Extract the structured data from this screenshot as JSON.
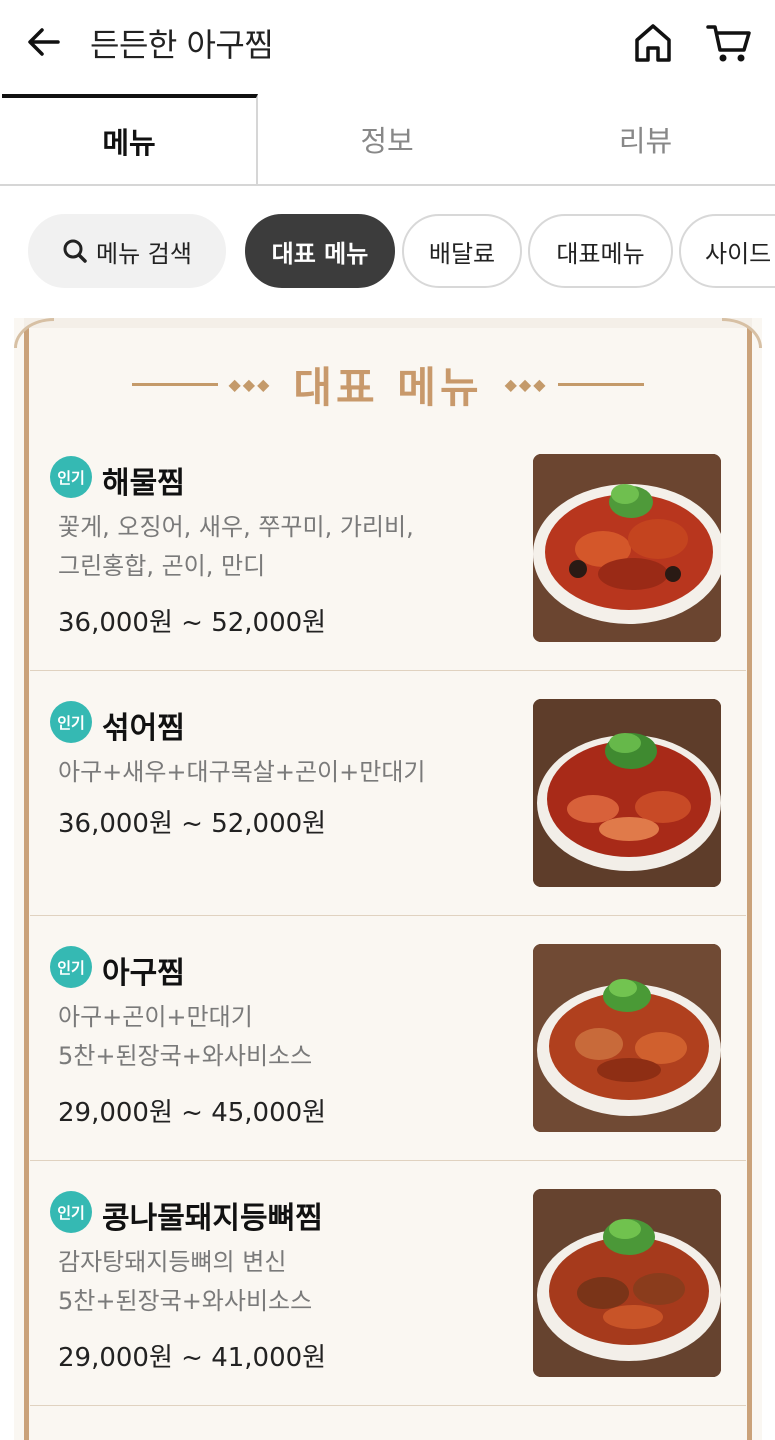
{
  "header": {
    "title": "든든한 아구찜",
    "icons": [
      "back-arrow-icon",
      "home-icon",
      "cart-icon"
    ]
  },
  "tabs": [
    {
      "label": "메뉴",
      "active": true
    },
    {
      "label": "정보",
      "active": false
    },
    {
      "label": "리뷰",
      "active": false
    }
  ],
  "chips": {
    "search": "메뉴 검색",
    "items": [
      "대표 메뉴",
      "배달료",
      "대표메뉴",
      "사이드"
    ],
    "active_index": 0
  },
  "section": {
    "title": "대표 메뉴"
  },
  "menu_items": [
    {
      "badge": "인기",
      "name": "해물찜",
      "desc1": "꽃게, 오징어, 새우, 쭈꾸미, 가리비,",
      "desc2": "그린홍합, 곤이, 만디",
      "price": "36,000원 ~ 52,000원"
    },
    {
      "badge": "인기",
      "name": "섞어찜",
      "desc1": "아구+새우+대구목살+곤이+만대기",
      "desc2": "",
      "price": "36,000원 ~ 52,000원"
    },
    {
      "badge": "인기",
      "name": "아구찜",
      "desc1": "아구+곤이+만대기",
      "desc2": "5찬+된장국+와사비소스",
      "price": "29,000원 ~ 45,000원"
    },
    {
      "badge": "인기",
      "name": "콩나물돼지등뼈찜",
      "desc1": "감자탕돼지등뼈의 변신",
      "desc2": "5찬+된장국+와사비소스",
      "price": "29,000원 ~ 41,000원"
    }
  ],
  "colors": {
    "accent_gold": "#c8996b",
    "badge_teal": "#35b9b3",
    "active_chip": "#3c3c3c"
  }
}
